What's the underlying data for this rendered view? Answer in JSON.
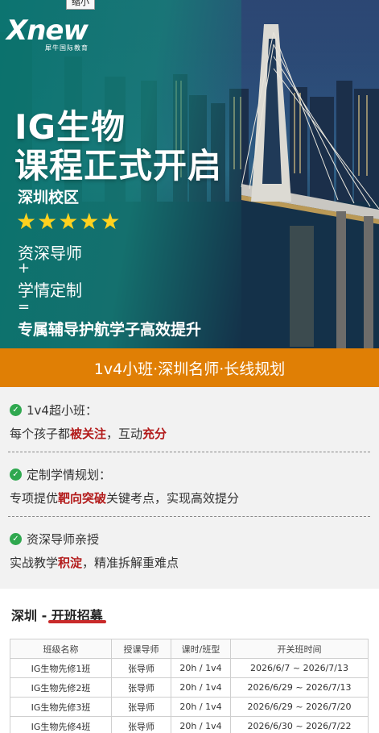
{
  "toolbar": {
    "shrink_label": "缩小"
  },
  "logo": {
    "mark": "Xnew",
    "sub": "犀牛国际教育"
  },
  "hero": {
    "title_line1": "IG生物",
    "title_line2": "课程正式开启",
    "campus": "深圳校区",
    "stars": "★★★★★",
    "line_a": "资深导师",
    "plus": "+",
    "line_b": "学情定制",
    "equals": "=",
    "line_c": "专属辅导护航学子高效提升"
  },
  "banner": {
    "text": "1v4小班·深圳名师·长线规划"
  },
  "features": [
    {
      "title": "1v4超小班：",
      "desc_pre": "每个孩子都",
      "hl1": "被关注",
      "desc_mid": "，互动",
      "hl2": "充分",
      "desc_post": ""
    },
    {
      "title": "定制学情规划：",
      "desc_pre": "专项提优",
      "hl1": "靶向突破",
      "desc_mid": "关键考点，实现高效提分",
      "hl2": "",
      "desc_post": ""
    },
    {
      "title": "资深导师亲授",
      "desc_pre": "实战教学",
      "hl1": "积淀",
      "desc_mid": "，精准拆解重难点",
      "hl2": "",
      "desc_post": ""
    }
  ],
  "schedule": {
    "title_prefix": "深圳 - ",
    "title_hl": "开班招募",
    "columns": [
      "班级名称",
      "授课导师",
      "课时/班型",
      "开关班时间"
    ],
    "rows": [
      [
        "IG生物先修1班",
        "张导师",
        "20h / 1v4",
        "2026/6/7 ~ 2026/7/13"
      ],
      [
        "IG生物先修2班",
        "张导师",
        "20h / 1v4",
        "2026/6/29 ~ 2026/7/13"
      ],
      [
        "IG生物先修3班",
        "张导师",
        "20h / 1v4",
        "2026/6/29 ~ 2026/7/20"
      ],
      [
        "IG生物先修4班",
        "张导师",
        "20h / 1v4",
        "2026/6/30 ~ 2026/7/22"
      ]
    ]
  },
  "colors": {
    "teal": "#0a7a70",
    "orange": "#e07f05",
    "highlight": "#b31b1b",
    "check": "#2fa84f",
    "star": "#ffd21f"
  }
}
